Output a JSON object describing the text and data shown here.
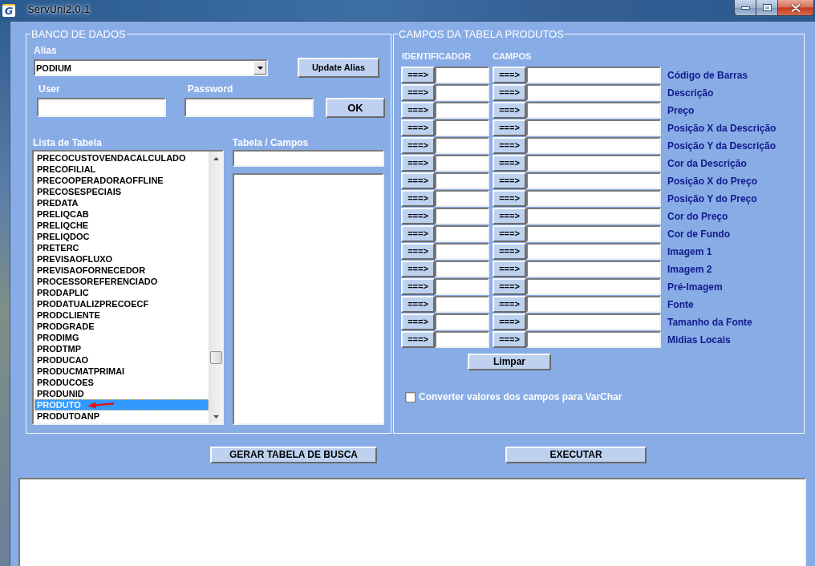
{
  "window": {
    "icon_letter": "G",
    "title": "ServUni2.0.1"
  },
  "database": {
    "title": "BANCO DE DADOS",
    "alias": {
      "label": "Alias",
      "value": "PODIUM"
    },
    "update_alias_button": "Update Alias",
    "user": {
      "label": "User"
    },
    "password": {
      "label": "Password"
    },
    "ok_button": "OK",
    "table_list": {
      "label": "Lista de Tabela",
      "items": [
        {
          "name": "PRECOCUSTOVENDACALCULADO",
          "selected": false
        },
        {
          "name": "PRECOFILIAL",
          "selected": false
        },
        {
          "name": "PRECOOPERADORAOFFLINE",
          "selected": false
        },
        {
          "name": "PRECOSESPECIAIS",
          "selected": false
        },
        {
          "name": "PREDATA",
          "selected": false
        },
        {
          "name": "PRELIQCAB",
          "selected": false
        },
        {
          "name": "PRELIQCHE",
          "selected": false
        },
        {
          "name": "PRELIQDOC",
          "selected": false
        },
        {
          "name": "PRETERC",
          "selected": false
        },
        {
          "name": "PREVISAOFLUXO",
          "selected": false
        },
        {
          "name": "PREVISAOFORNECEDOR",
          "selected": false
        },
        {
          "name": "PROCESSOREFERENCIADO",
          "selected": false
        },
        {
          "name": "PRODAPLIC",
          "selected": false
        },
        {
          "name": "PRODATUALIZPRECOECF",
          "selected": false
        },
        {
          "name": "PRODCLIENTE",
          "selected": false
        },
        {
          "name": "PRODGRADE",
          "selected": false
        },
        {
          "name": "PRODIMG",
          "selected": false
        },
        {
          "name": "PRODTMP",
          "selected": false
        },
        {
          "name": "PRODUCAO",
          "selected": false
        },
        {
          "name": "PRODUCMATPRIMAI",
          "selected": false
        },
        {
          "name": "PRODUCOES",
          "selected": false
        },
        {
          "name": "PRODUNID",
          "selected": false
        },
        {
          "name": "PRODUTO",
          "selected": true
        },
        {
          "name": "PRODUTOANP",
          "selected": false
        }
      ]
    },
    "table_fields": {
      "label": "Tabela / Campos"
    }
  },
  "product_fields": {
    "title": "CAMPOS DA TABELA PRODUTOS",
    "identifier_header": "IDENTIFICADOR",
    "fields_header": "CAMPOS",
    "rows": [
      {
        "identifier_button": "===>",
        "field_button": "===>",
        "label": "Código de Barras"
      },
      {
        "identifier_button": "===>",
        "field_button": "===>",
        "label": "Descrição"
      },
      {
        "identifier_button": "===>",
        "field_button": "===>",
        "label": "Preço"
      },
      {
        "identifier_button": "===>",
        "field_button": "===>",
        "label": "Posição X da Descrição"
      },
      {
        "identifier_button": "===>",
        "field_button": "===>",
        "label": "Posição Y da Descrição"
      },
      {
        "identifier_button": "===>",
        "field_button": "===>",
        "label": "Cor da Descrição"
      },
      {
        "identifier_button": "===>",
        "field_button": "===>",
        "label": "Posição X do Preço"
      },
      {
        "identifier_button": "===>",
        "field_button": "===>",
        "label": "Posição Y do Preço"
      },
      {
        "identifier_button": "===>",
        "field_button": "===>",
        "label": "Cor do Preço"
      },
      {
        "identifier_button": "===>",
        "field_button": "===>",
        "label": "Cor de Fundo"
      },
      {
        "identifier_button": "===>",
        "field_button": "===>",
        "label": "Imagem 1"
      },
      {
        "identifier_button": "===>",
        "field_button": "===>",
        "label": "Imagem 2"
      },
      {
        "identifier_button": "===>",
        "field_button": "===>",
        "label": "Pré-Imagem"
      },
      {
        "identifier_button": "===>",
        "field_button": "===>",
        "label": "Fonte"
      },
      {
        "identifier_button": "===>",
        "field_button": "===>",
        "label": "Tamanho da Fonte"
      },
      {
        "identifier_button": "===>",
        "field_button": "===>",
        "label": "Midias Locais"
      }
    ],
    "clear_button": "Limpar",
    "convert_option": {
      "label": "Converter valores dos campos para VarChar",
      "checked": false
    }
  },
  "actions": [
    {
      "label": "GERAR TABELA DE BUSCA"
    },
    {
      "label": "EXECUTAR"
    }
  ]
}
